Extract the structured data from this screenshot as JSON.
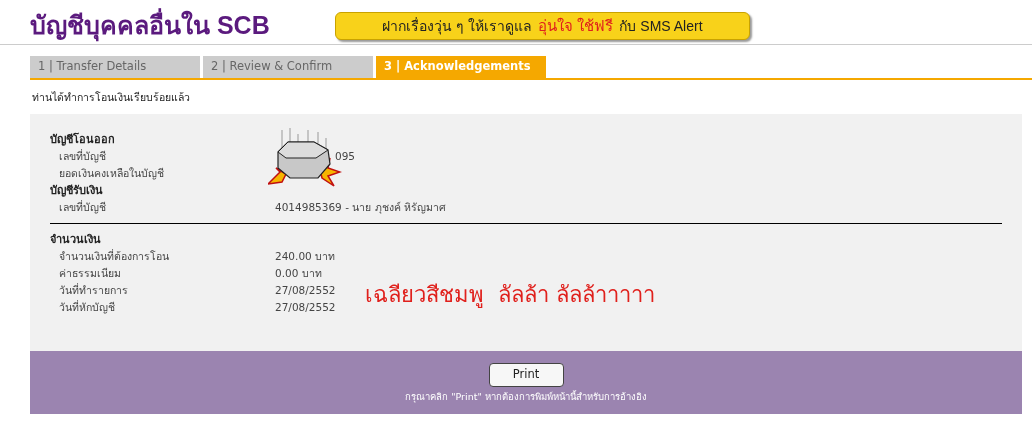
{
  "page_title": "บัญชีบุคคลอื่นใน SCB",
  "banner": {
    "text_before": "ฝากเรื่องวุ่น ๆ ให้เราดูแล",
    "highlight": "อุ่นใจ ใช้ฟรี",
    "text_after": "กับ SMS Alert"
  },
  "tabs": [
    {
      "label": "1 | Transfer Details",
      "selected": false
    },
    {
      "label": "2 | Review & Confirm",
      "selected": false
    },
    {
      "label": "3 | Acknowledgements",
      "selected": true
    }
  ],
  "message": "ท่านได้ทำการโอนเงินเรียบร้อยแล้ว",
  "sections": [
    {
      "heading": "บัญชีโอนออก",
      "rows": [
        {
          "label": "เลขที่บัญชี",
          "value": "095"
        },
        {
          "label": "ยอดเงินคงเหลือในบัญชี"
        }
      ],
      "divider": false
    },
    {
      "heading": "บัญชีรับเงิน",
      "rows": [
        {
          "label": "เลขที่บัญชี",
          "value": "4014985369 - นาย ภุชงค์ หิรัญมาศ"
        }
      ],
      "divider": true
    },
    {
      "heading": "จำนวนเงิน",
      "rows": [
        {
          "label": "จำนวนเงินที่ต้องการโอน",
          "value": "240.00 บาท"
        },
        {
          "label": "ค่าธรรมเนียม",
          "value": "0.00 บาท"
        },
        {
          "label": "วันที่ทำรายการ",
          "value": "27/08/2552"
        },
        {
          "label": "วันที่หักบัญชี",
          "value": "27/08/2552"
        }
      ],
      "divider": false
    }
  ],
  "overlay_caption": "เฉลียวสีชมพู  ลัลล้า ลัลล้าาาาา",
  "print_button": "Print",
  "footer_note": "กรุณาคลิก \"Print\" หากต้องการพิมพ์หน้านี้สำหรับการอ้างอิง"
}
